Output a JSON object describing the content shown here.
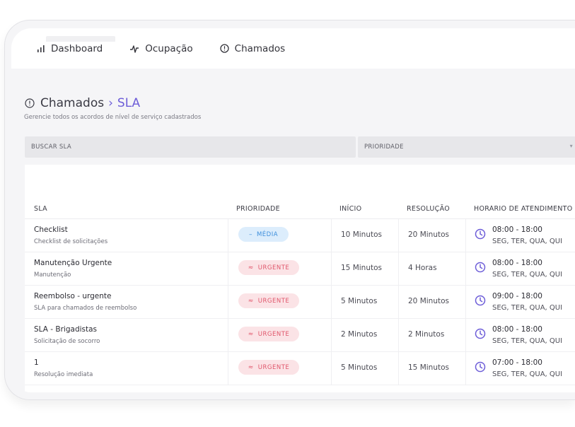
{
  "nav": {
    "items": [
      {
        "label": "Dashboard",
        "icon": "bar-chart-icon"
      },
      {
        "label": "Ocupação",
        "icon": "activity-icon"
      },
      {
        "label": "Chamados",
        "icon": "alert-circle-icon"
      }
    ]
  },
  "breadcrumb": {
    "parent": "Chamados",
    "separator": "›",
    "current": "SLA"
  },
  "subtitle": "Gerencie todos os acordos de nível de serviço cadastrados",
  "filters": {
    "search_placeholder": "BUSCAR SLA",
    "priority_label": "PRIORIDADE"
  },
  "table": {
    "columns": [
      "SLA",
      "PRIORIDADE",
      "INÍCIO",
      "RESOLUÇÃO",
      "HORÁRIO DE ATENDIMENTO"
    ],
    "rows": [
      {
        "name": "Checklist",
        "description": "Checklist de solicitações",
        "priority": "MÉDIA",
        "priority_icon": "–",
        "start": "10 Minutos",
        "resolution": "20 Minutos",
        "hours": "08:00 - 18:00",
        "days": "SEG, TER, QUA, QUI"
      },
      {
        "name": "Manutenção Urgente",
        "description": "Manutenção",
        "priority": "URGENTE",
        "priority_icon": "≈",
        "start": "15 Minutos",
        "resolution": "4 Horas",
        "hours": "08:00 - 18:00",
        "days": "SEG, TER, QUA, QUI"
      },
      {
        "name": "Reembolso - urgente",
        "description": "SLA para chamados de reembolso",
        "priority": "URGENTE",
        "priority_icon": "≈",
        "start": "5 Minutos",
        "resolution": "20 Minutos",
        "hours": "09:00 - 18:00",
        "days": "SEG, TER, QUA, QUI"
      },
      {
        "name": "SLA - Brigadistas",
        "description": "Solicitação de socorro",
        "priority": "URGENTE",
        "priority_icon": "≈",
        "start": "2 Minutos",
        "resolution": "2 Minutos",
        "hours": "08:00 - 18:00",
        "days": "SEG, TER, QUA, QUI"
      },
      {
        "name": "1",
        "description": "Resolução imediata",
        "priority": "URGENTE",
        "priority_icon": "≈",
        "start": "5 Minutos",
        "resolution": "15 Minutos",
        "hours": "07:00 - 18:00",
        "days": "SEG, TER, QUA, QUI"
      }
    ]
  },
  "colors": {
    "accent": "#6d5dd8",
    "media_bg": "#dcedfc",
    "media_fg": "#3e8fdc",
    "urgente_bg": "#fbe3e6",
    "urgente_fg": "#e0566b"
  }
}
